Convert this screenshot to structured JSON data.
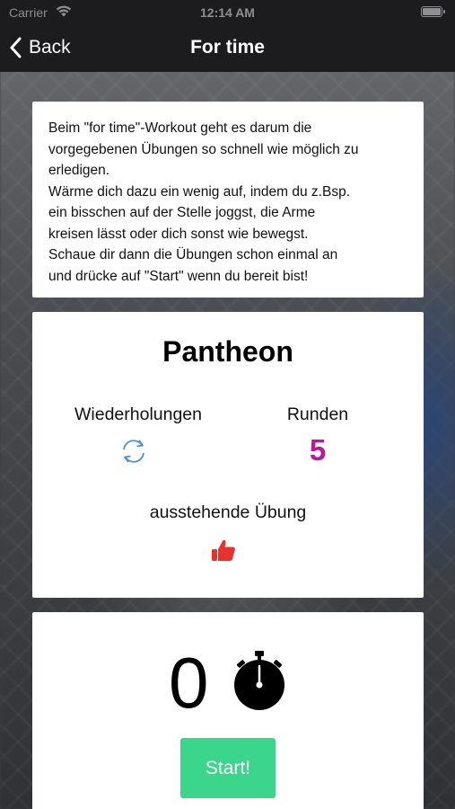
{
  "status_bar": {
    "carrier": "Carrier",
    "time": "12:14 AM",
    "wifi_icon": "wifi-icon",
    "battery_icon": "battery-icon"
  },
  "nav": {
    "back_label": "Back",
    "back_icon": "chevron-left-icon",
    "title": "For time"
  },
  "intro": {
    "text": "Beim \"for time\"-Workout geht es darum die\nvorgegebenen Übungen so schnell wie möglich zu\nerledigen.\nWärme dich dazu ein wenig auf, indem du z.Bsp.\nein bisschen auf der Stelle joggst, die Arme\nkreisen lässt oder dich sonst wie bewegst.\nSchaue dir dann die Übungen schon einmal an\nund drücke auf \"Start\" wenn du bereit bist!"
  },
  "workout": {
    "name": "Pantheon",
    "reps_label": "Wiederholungen",
    "reps_icon": "refresh-icon",
    "rounds_label": "Runden",
    "rounds_value": "5",
    "pending_label": "ausstehende Übung",
    "pending_icon": "thumbs-up-icon"
  },
  "timer": {
    "value": "0",
    "icon": "stopwatch-icon",
    "start_label": "Start!"
  },
  "colors": {
    "bar_background": "#1c1c1e",
    "rounds_accent": "#c2149b",
    "refresh_icon": "#4a90d9",
    "thumbs_up_icon": "#e8322c",
    "start_button": "#3bd68b"
  }
}
